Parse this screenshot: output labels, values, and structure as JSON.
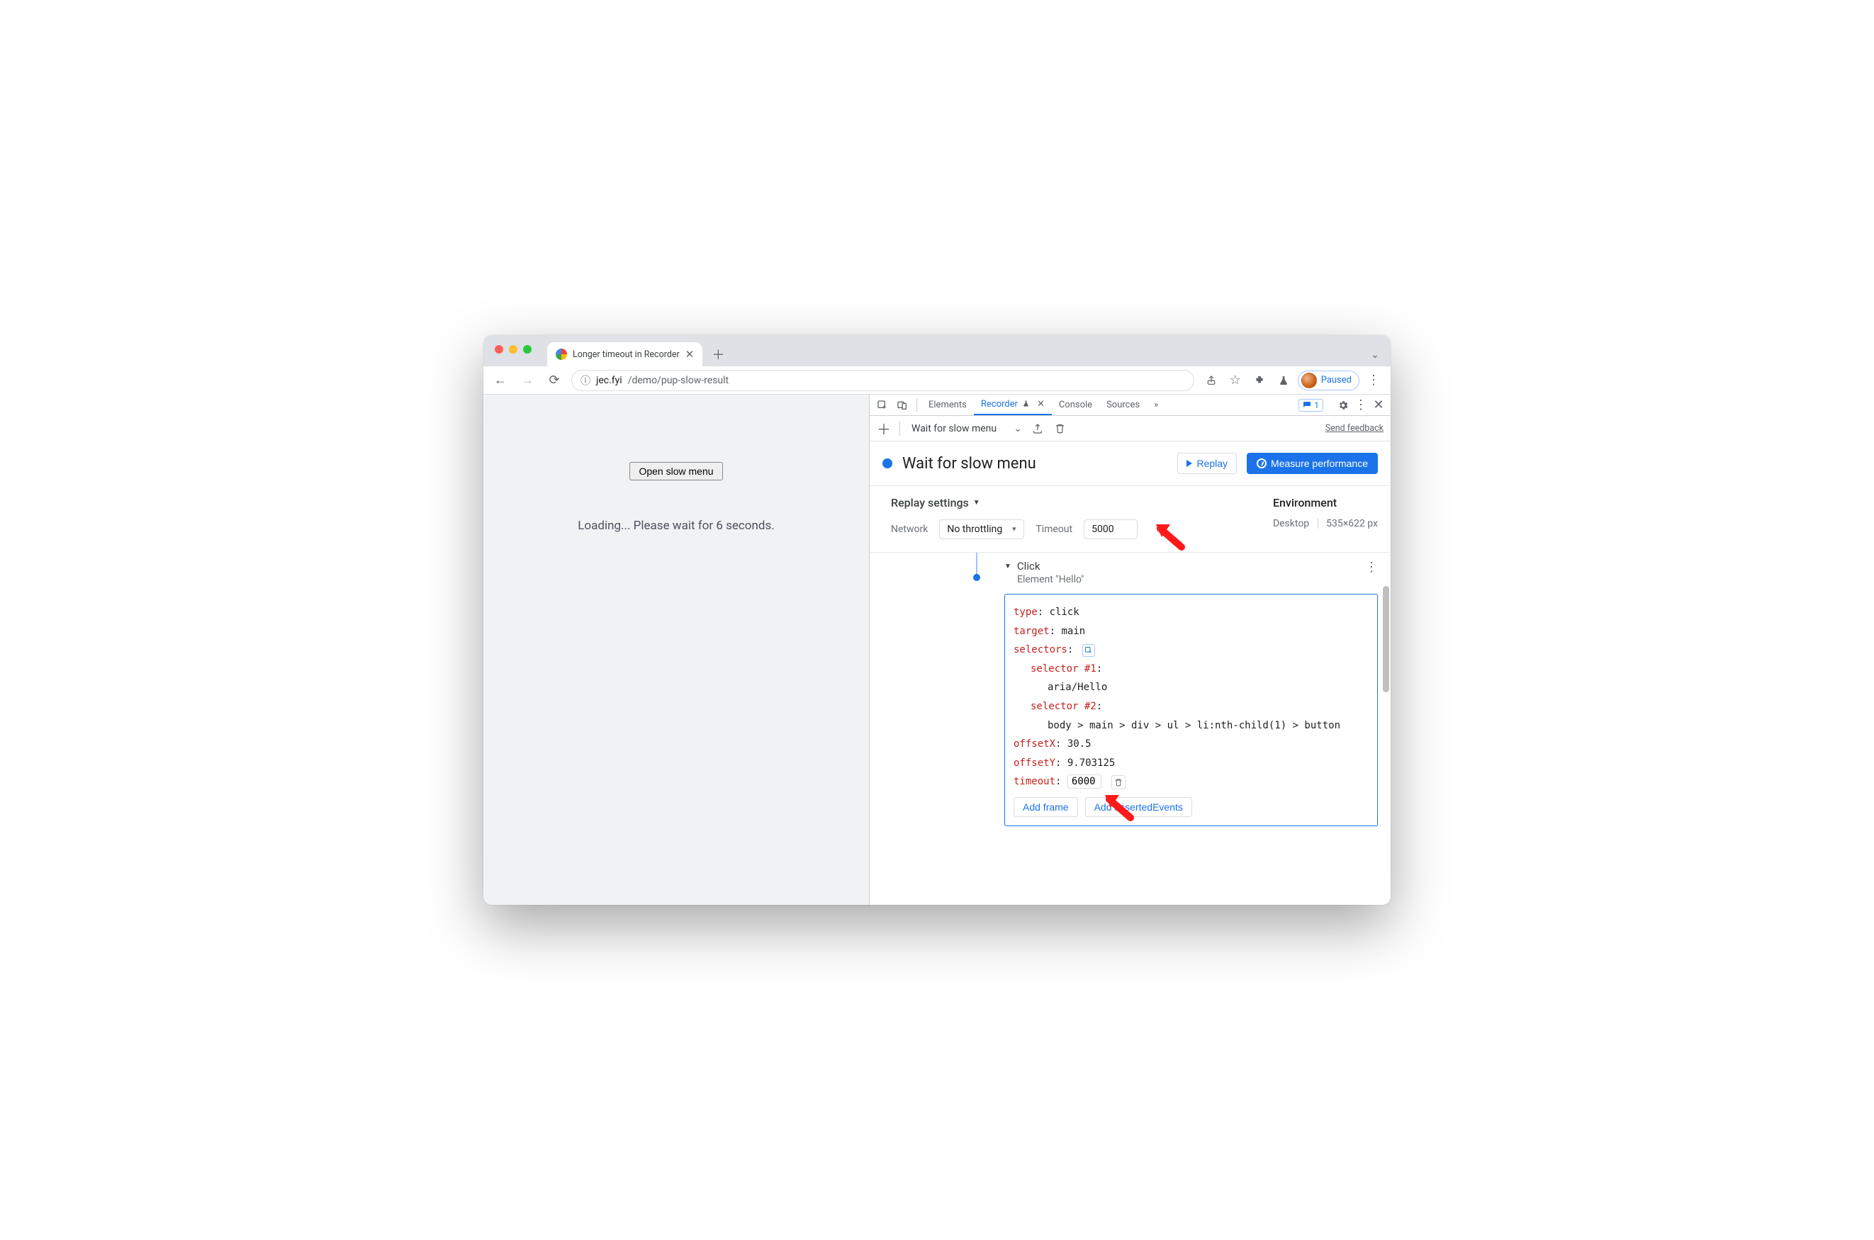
{
  "browser": {
    "tab_title": "Longer timeout in Recorder",
    "url_host": "jec.fyi",
    "url_path": "/demo/pup-slow-result",
    "profile_label": "Paused"
  },
  "page": {
    "button_label": "Open slow menu",
    "loading_text": "Loading... Please wait for 6 seconds."
  },
  "devtools": {
    "tabs": {
      "elements": "Elements",
      "recorder": "Recorder",
      "console": "Console",
      "sources": "Sources"
    },
    "issues_count": "1",
    "toolbar": {
      "recording_name": "Wait for slow menu",
      "feedback": "Send feedback"
    },
    "header": {
      "title": "Wait for slow menu",
      "replay": "Replay",
      "measure": "Measure performance"
    },
    "settings": {
      "title": "Replay settings",
      "network_label": "Network",
      "network_value": "No throttling",
      "timeout_label": "Timeout",
      "timeout_value": "5000"
    },
    "environment": {
      "title": "Environment",
      "device": "Desktop",
      "viewport": "535×622 px"
    },
    "step": {
      "title": "Click",
      "subtitle": "Element \"Hello\"",
      "type_k": "type",
      "type_v": "click",
      "target_k": "target",
      "target_v": "main",
      "selectors_k": "selectors",
      "sel1_k": "selector #1",
      "sel1_v": "aria/Hello",
      "sel2_k": "selector #2",
      "sel2_v": "body > main > div > ul > li:nth-child(1) > button",
      "offx_k": "offsetX",
      "offx_v": "30.5",
      "offy_k": "offsetY",
      "offy_v": "9.703125",
      "timeout_k": "timeout",
      "timeout_v": "6000",
      "add_frame": "Add frame",
      "add_asserted": "Add assertedEvents"
    }
  }
}
